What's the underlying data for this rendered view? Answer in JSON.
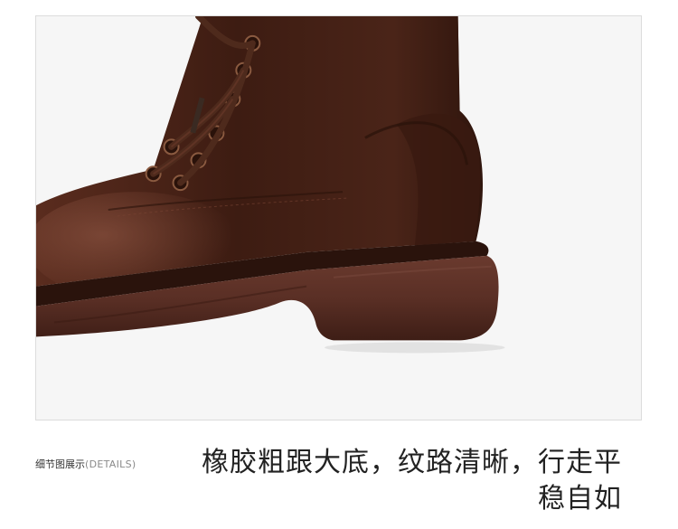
{
  "detail_label": {
    "zh": "细节图展示",
    "en": "(DETAILS)"
  },
  "caption": {
    "line1": "橡胶粗跟大底，纹路清晰，行走平",
    "line2": "稳自如"
  },
  "colors": {
    "leather": "#4a2418",
    "leather_highlight": "#6b3a2a",
    "sole": "#5a2f25",
    "lace": "#4e2a1c",
    "background": "#f6f6f6",
    "frame_border": "#dcdcdc"
  },
  "image": {
    "subject": "brown-leather-lace-up-boot-heel-detail"
  }
}
